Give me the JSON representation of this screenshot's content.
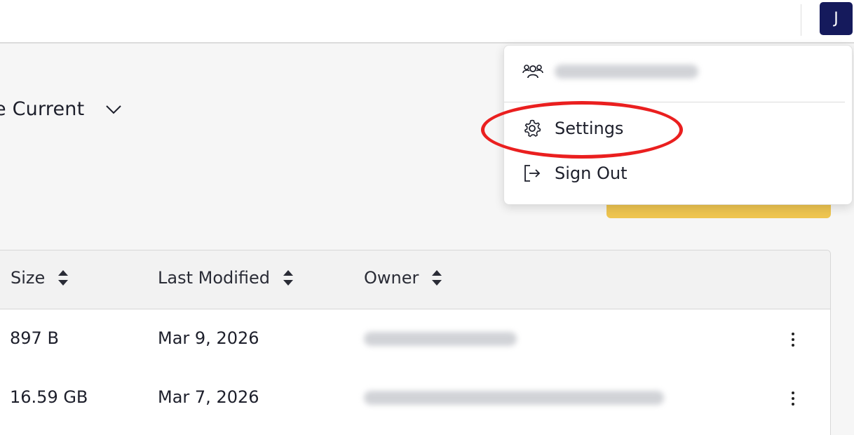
{
  "header": {
    "avatar_initial": "J"
  },
  "filter": {
    "label": "e Current"
  },
  "table": {
    "columns": [
      {
        "label": "Size"
      },
      {
        "label": "Last Modified"
      },
      {
        "label": "Owner"
      }
    ],
    "rows": [
      {
        "size": "897 B",
        "last_modified": "Mar 9, 2026",
        "owner": ""
      },
      {
        "size": "16.59 GB",
        "last_modified": "Mar 7, 2026",
        "owner": ""
      }
    ]
  },
  "user_menu": {
    "account_label": "",
    "items": [
      {
        "label": "Settings",
        "icon": "gear-icon"
      },
      {
        "label": "Sign Out",
        "icon": "sign-out-icon"
      }
    ]
  },
  "colors": {
    "avatar_bg": "#151a5c",
    "accent_button": "#eec550",
    "highlight": "#ea1f1f"
  }
}
